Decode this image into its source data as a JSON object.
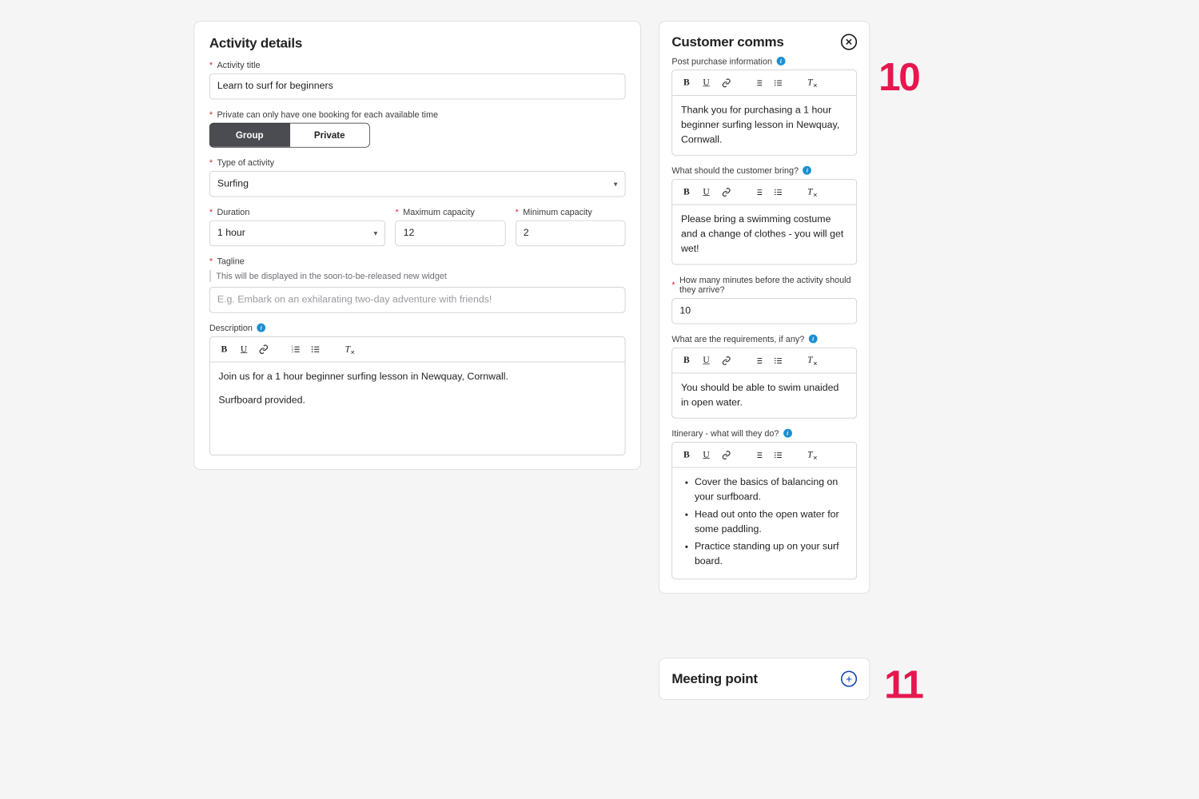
{
  "annotations": {
    "num10": "10",
    "num11": "11"
  },
  "activity": {
    "title": "Activity details",
    "fields": {
      "activityTitle": {
        "label": "Activity title",
        "value": "Learn to surf for beginners"
      },
      "bookingType": {
        "label": "Private can only have one booking for each available time",
        "group": "Group",
        "private": "Private"
      },
      "activityType": {
        "label": "Type of activity",
        "value": "Surfing"
      },
      "duration": {
        "label": "Duration",
        "value": "1 hour"
      },
      "maxCap": {
        "label": "Maximum capacity",
        "value": "12"
      },
      "minCap": {
        "label": "Minimum capacity",
        "value": "2"
      },
      "tagline": {
        "label": "Tagline",
        "helper": "This will be displayed in the soon-to-be-released new widget",
        "placeholder": "E.g. Embark on an exhilarating two-day adventure with friends!"
      },
      "description": {
        "label": "Description",
        "p1": "Join us for a 1 hour beginner surfing lesson in Newquay, Cornwall.",
        "p2": "Surfboard provided."
      }
    }
  },
  "comms": {
    "title": "Customer comms",
    "postPurchase": {
      "label": "Post purchase information",
      "text": "Thank you for purchasing a 1 hour beginner surfing lesson in Newquay, Cornwall."
    },
    "bring": {
      "label": "What should the customer bring?",
      "text": "Please bring a swimming costume and a change of clothes - you will get wet!"
    },
    "arrive": {
      "label": "How many minutes before the activity should they arrive?",
      "value": "10"
    },
    "requirements": {
      "label": "What are the requirements, if any?",
      "text": "You should be able to swim unaided in open water."
    },
    "itinerary": {
      "label": "Itinerary - what will they do?",
      "i1": "Cover the basics of balancing on your surfboard.",
      "i2": "Head out onto the open water for some paddling.",
      "i3": "Practice standing up on your surf board."
    }
  },
  "meeting": {
    "title": "Meeting point"
  },
  "rteButtons": [
    "B",
    "U",
    "🔗",
    "1≡",
    "•≡",
    "Tx"
  ]
}
